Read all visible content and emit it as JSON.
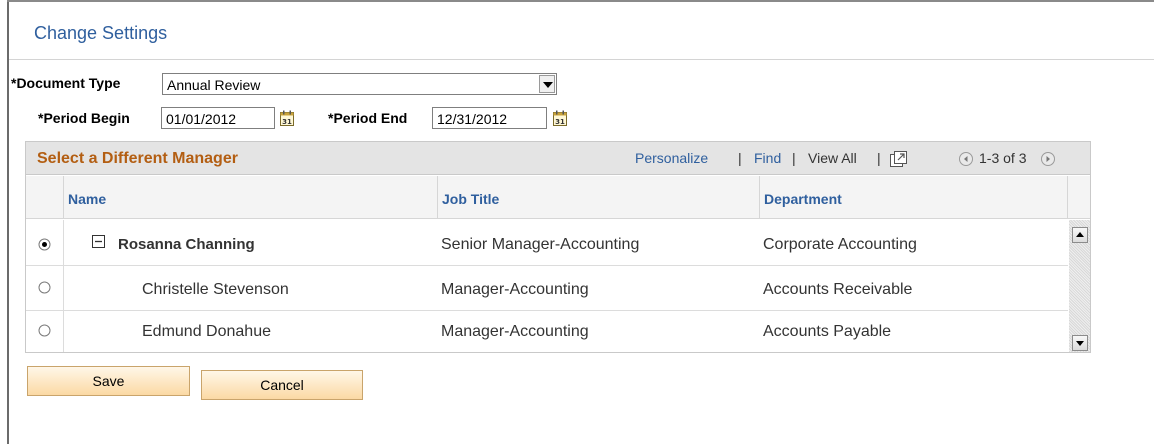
{
  "page": {
    "title": "Change Settings"
  },
  "form": {
    "document_type": {
      "label": "*Document Type",
      "value": "Annual Review"
    },
    "period_begin": {
      "label": "*Period Begin",
      "value": "01/01/2012"
    },
    "period_end": {
      "label": "*Period End",
      "value": "12/31/2012"
    }
  },
  "grid": {
    "title": "Select a Different Manager",
    "nav": {
      "personalize": "Personalize",
      "find": "Find",
      "view_all": "View All",
      "separator": "|",
      "range": "1-3 of 3"
    },
    "columns": [
      "Name",
      "Job Title",
      "Department"
    ],
    "rows": [
      {
        "name": "Rosanna Channing",
        "job_title": "Senior Manager-Accounting",
        "department": "Corporate Accounting",
        "selected": true,
        "expanded": true
      },
      {
        "name": "Christelle Stevenson",
        "job_title": "Manager-Accounting",
        "department": "Accounts Receivable",
        "selected": false
      },
      {
        "name": "Edmund Donahue",
        "job_title": "Manager-Accounting",
        "department": "Accounts Payable",
        "selected": false
      }
    ]
  },
  "buttons": {
    "save": "Save",
    "cancel": "Cancel"
  },
  "icons": {
    "calendar": "calendar-icon",
    "zoom": "new-window-icon",
    "prev": "previous-arrow-icon",
    "next": "next-arrow-icon",
    "collapse": "collapse-minus-icon"
  },
  "colors": {
    "title": "#2f5f9e",
    "grid_title": "#b35e12",
    "link": "#2f5f9e",
    "button_fill": "#fbd9a4"
  }
}
